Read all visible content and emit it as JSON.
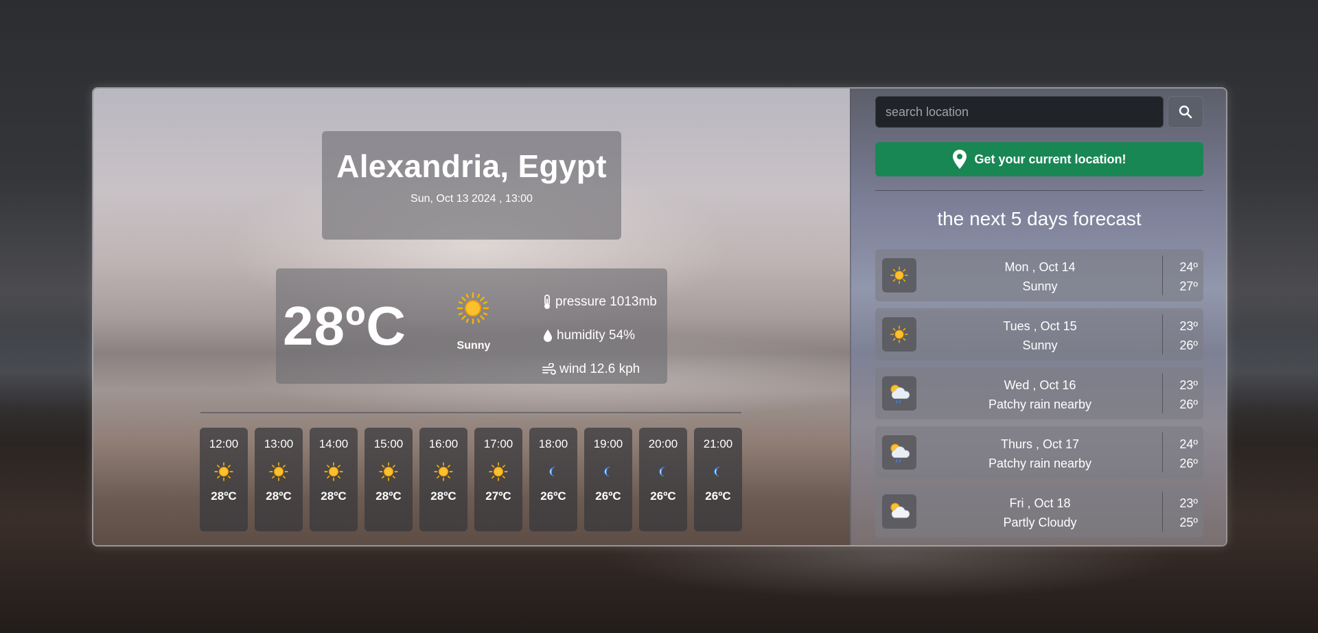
{
  "location": {
    "title": "Alexandria, Egypt",
    "datetime": "Sun, Oct 13 2024 , 13:00"
  },
  "current": {
    "temperature": "28ºC",
    "condition": "Sunny",
    "condition_icon": "sun-icon",
    "pressure": "pressure 1013mb",
    "humidity": "humidity 54%",
    "wind": "wind 12.6 kph"
  },
  "hourly": [
    {
      "time": "12:00",
      "icon": "sun-icon",
      "temp": "28ºC"
    },
    {
      "time": "13:00",
      "icon": "sun-icon",
      "temp": "28ºC"
    },
    {
      "time": "14:00",
      "icon": "sun-icon",
      "temp": "28ºC"
    },
    {
      "time": "15:00",
      "icon": "sun-icon",
      "temp": "28ºC"
    },
    {
      "time": "16:00",
      "icon": "sun-icon",
      "temp": "28ºC"
    },
    {
      "time": "17:00",
      "icon": "sun-icon",
      "temp": "27ºC"
    },
    {
      "time": "18:00",
      "icon": "moon-icon",
      "temp": "26ºC"
    },
    {
      "time": "19:00",
      "icon": "moon-icon",
      "temp": "26ºC"
    },
    {
      "time": "20:00",
      "icon": "moon-icon",
      "temp": "26ºC"
    },
    {
      "time": "21:00",
      "icon": "moon-icon",
      "temp": "26ºC"
    }
  ],
  "search": {
    "placeholder": "search location",
    "value": ""
  },
  "location_button": {
    "label": "Get your current location!"
  },
  "forecast": {
    "title": "the next 5 days forecast",
    "days": [
      {
        "date": "Mon , Oct 14",
        "condition": "Sunny",
        "icon": "sun-icon",
        "min": "24º",
        "max": "27º"
      },
      {
        "date": "Tues , Oct 15",
        "condition": "Sunny",
        "icon": "sun-icon",
        "min": "23º",
        "max": "26º"
      },
      {
        "date": "Wed , Oct 16",
        "condition": "Patchy rain nearby",
        "icon": "patchy-rain-icon",
        "min": "23º",
        "max": "26º"
      },
      {
        "date": "Thurs , Oct 17",
        "condition": "Patchy rain nearby",
        "icon": "patchy-rain-icon",
        "min": "24º",
        "max": "26º"
      },
      {
        "date": "Fri , Oct 18",
        "condition": "Partly Cloudy",
        "icon": "partly-cloudy-icon",
        "min": "23º",
        "max": "25º"
      }
    ]
  },
  "colors": {
    "location_button": "#198754",
    "search_input_bg": "#202327",
    "sun": "#f7b500"
  }
}
